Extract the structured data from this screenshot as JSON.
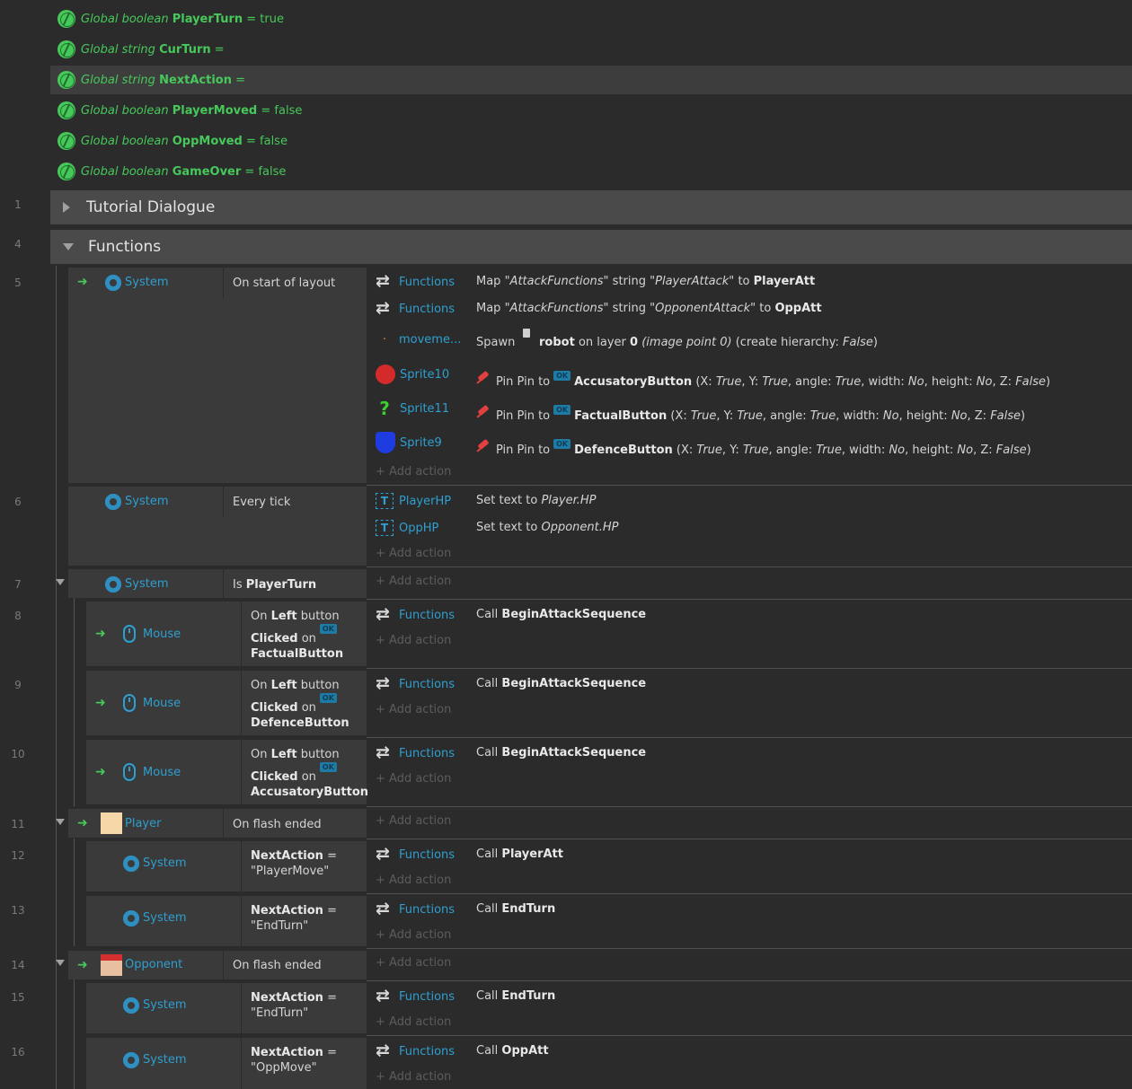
{
  "globals": [
    {
      "kind": "Global boolean",
      "name": "PlayerTurn",
      "value": "= true"
    },
    {
      "kind": "Global string",
      "name": "CurTurn",
      "value": "="
    },
    {
      "kind": "Global string",
      "name": "NextAction",
      "value": "="
    },
    {
      "kind": "Global boolean",
      "name": "PlayerMoved",
      "value": "= false"
    },
    {
      "kind": "Global boolean",
      "name": "OppMoved",
      "value": "= false"
    },
    {
      "kind": "Global boolean",
      "name": "GameOver",
      "value": "= false"
    }
  ],
  "groups": {
    "tutorial": "Tutorial Dialogue",
    "functions": "Functions"
  },
  "line_numbers": [
    "1",
    "4",
    "5",
    "6",
    "7",
    "8",
    "9",
    "10",
    "11",
    "12",
    "13",
    "14",
    "15",
    "16"
  ],
  "common": {
    "add_action": "Add action",
    "functions": "Functions",
    "system": "System",
    "mouse": "Mouse",
    "on": "On",
    "left": "Left",
    "button": "button",
    "clicked": "Clicked",
    "on_lc": "on",
    "next_action": "NextAction",
    "eq": "=",
    "call": "Call"
  },
  "ev5": {
    "cond": "On start of layout",
    "a1_text_pre": "Map",
    "a1_q1": "\"AttackFunctions\"",
    "a1_mid": "string",
    "a1_q2": "\"PlayerAttack\"",
    "a1_to": "to",
    "a1_target": "PlayerAtt",
    "a2_q2": "\"OpponentAttack\"",
    "a2_target": "OppAtt",
    "a3_obj": "moveme...",
    "a3_pre": "Spawn",
    "a3_name": "robot",
    "a3_layer": "on layer",
    "a3_layer_n": "0",
    "a3_ip": "(image point 0)",
    "a3_ch": "(create hierarchy:",
    "a3_ch_v": "False",
    "a4_obj": "Sprite10",
    "a5_obj": "Sprite11",
    "a6_obj": "Sprite9",
    "pin_pre": "Pin Pin to",
    "pin_btn1": "AccusatoryButton",
    "pin_btn2": "FactualButton",
    "pin_btn3": "DefenceButton",
    "pin_x": "(X:",
    "pin_y": "Y:",
    "pin_angle": "angle:",
    "pin_width": "width:",
    "pin_height": "height:",
    "pin_z": "Z:",
    "true": "True",
    "no": "No",
    "false": "False"
  },
  "ev6": {
    "cond": "Every tick",
    "a1_obj": "PlayerHP",
    "a1_text": "Set text to",
    "a1_val": "Player.HP",
    "a2_obj": "OppHP",
    "a2_val": "Opponent.HP"
  },
  "ev7": {
    "cond_pre": "Is",
    "cond_name": "PlayerTurn"
  },
  "ev8": {
    "btn": "FactualButton",
    "call": "BeginAttackSequence"
  },
  "ev9": {
    "btn": "DefenceButton",
    "call": "BeginAttackSequence"
  },
  "ev10": {
    "btn": "AccusatoryButton",
    "call": "BeginAttackSequence"
  },
  "ev11": {
    "obj": "Player",
    "cond": "On flash ended"
  },
  "ev12": {
    "val": "\"PlayerMove\"",
    "call": "PlayerAtt"
  },
  "ev13": {
    "val": "\"EndTurn\"",
    "call": "EndTurn"
  },
  "ev14": {
    "obj": "Opponent",
    "cond": "On flash ended"
  },
  "ev15": {
    "val": "\"EndTurn\"",
    "call": "EndTurn"
  },
  "ev16": {
    "val": "\"OppMove\"",
    "call": "OppAtt"
  },
  "colors": {
    "accent": "#2e9fd0",
    "global": "#46c85a",
    "bg": "#2b2b2b",
    "block": "#3a3a3a",
    "group": "#4a4a4a"
  }
}
